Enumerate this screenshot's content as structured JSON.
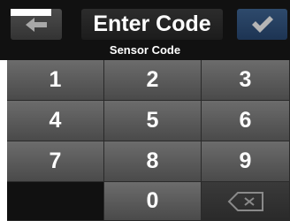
{
  "header": {
    "title": "Enter Code",
    "subtitle": "Sensor Code",
    "back_icon": "arrow-left-icon",
    "confirm_icon": "checkmark-icon"
  },
  "keypad": {
    "keys": [
      "1",
      "2",
      "3",
      "4",
      "5",
      "6",
      "7",
      "8",
      "9",
      "",
      "0",
      "delete"
    ],
    "delete_icon": "backspace-icon"
  },
  "colors": {
    "background": "#111111",
    "key": "#5a5a5a",
    "confirm": "#243f61"
  }
}
